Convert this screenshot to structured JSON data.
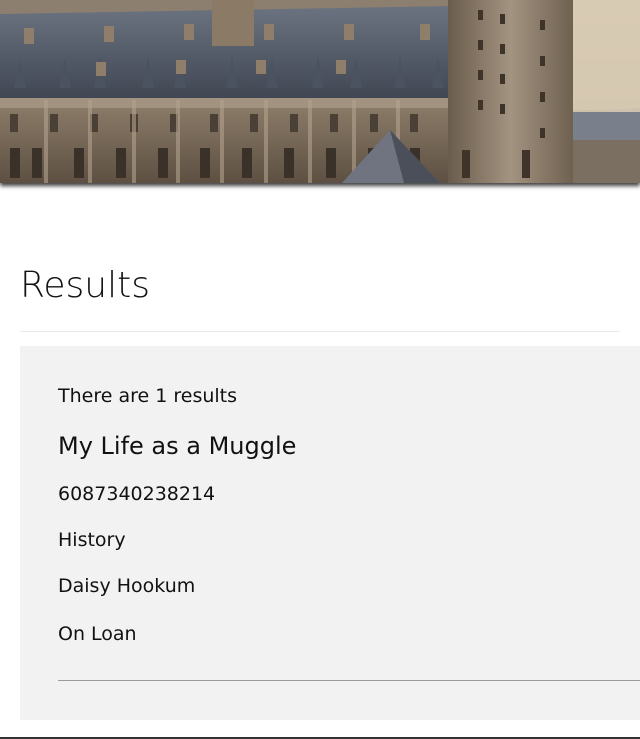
{
  "banner": {
    "image": "castle-banner"
  },
  "page": {
    "heading": "Results"
  },
  "results": {
    "count_text": "There are 1 results",
    "items": [
      {
        "title": "My Life as a Muggle",
        "isbn": "6087340238214",
        "genre": "History",
        "author": "Daisy Hookum",
        "status": "On Loan"
      }
    ]
  }
}
